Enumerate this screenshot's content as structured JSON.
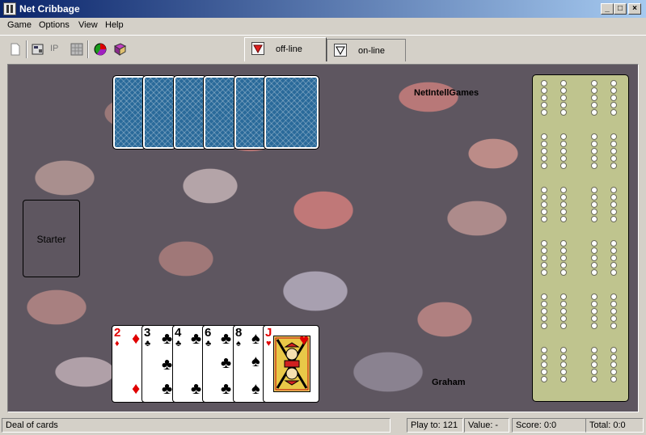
{
  "window": {
    "title": "Net Cribbage",
    "minimize_glyph": "_",
    "maximize_glyph": "□",
    "close_glyph": "×"
  },
  "menu": [
    "Game",
    "Options",
    "View",
    "Help"
  ],
  "toolbar": {
    "ip_label": "IP",
    "icons": [
      "new-document-icon",
      "settings-icon",
      "ip-icon",
      "grid-icon",
      "pie-chart-icon",
      "book-icon"
    ]
  },
  "tabs": [
    {
      "label": "off-line",
      "active": true,
      "glyph": "red-down-triangle"
    },
    {
      "label": "on-line",
      "active": false,
      "glyph": "outline-down-triangle"
    }
  ],
  "game": {
    "opponent_name": "NetIntellGames",
    "player_name": "Graham",
    "starter_label": "Starter",
    "opponent_cards_face_down": 6,
    "player_hand": [
      {
        "rank": "2",
        "suit": "♦",
        "color": "red"
      },
      {
        "rank": "3",
        "suit": "♣",
        "color": "black"
      },
      {
        "rank": "4",
        "suit": "♣",
        "color": "black"
      },
      {
        "rank": "6",
        "suit": "♣",
        "color": "black"
      },
      {
        "rank": "8",
        "suit": "♠",
        "color": "black"
      },
      {
        "rank": "J",
        "suit": "♥",
        "color": "red"
      }
    ]
  },
  "status": {
    "message": "Deal of cards",
    "play_to": "Play to: 121",
    "value": "Value: -",
    "score": "Score: 0:0",
    "total": "Total: 0:0"
  }
}
